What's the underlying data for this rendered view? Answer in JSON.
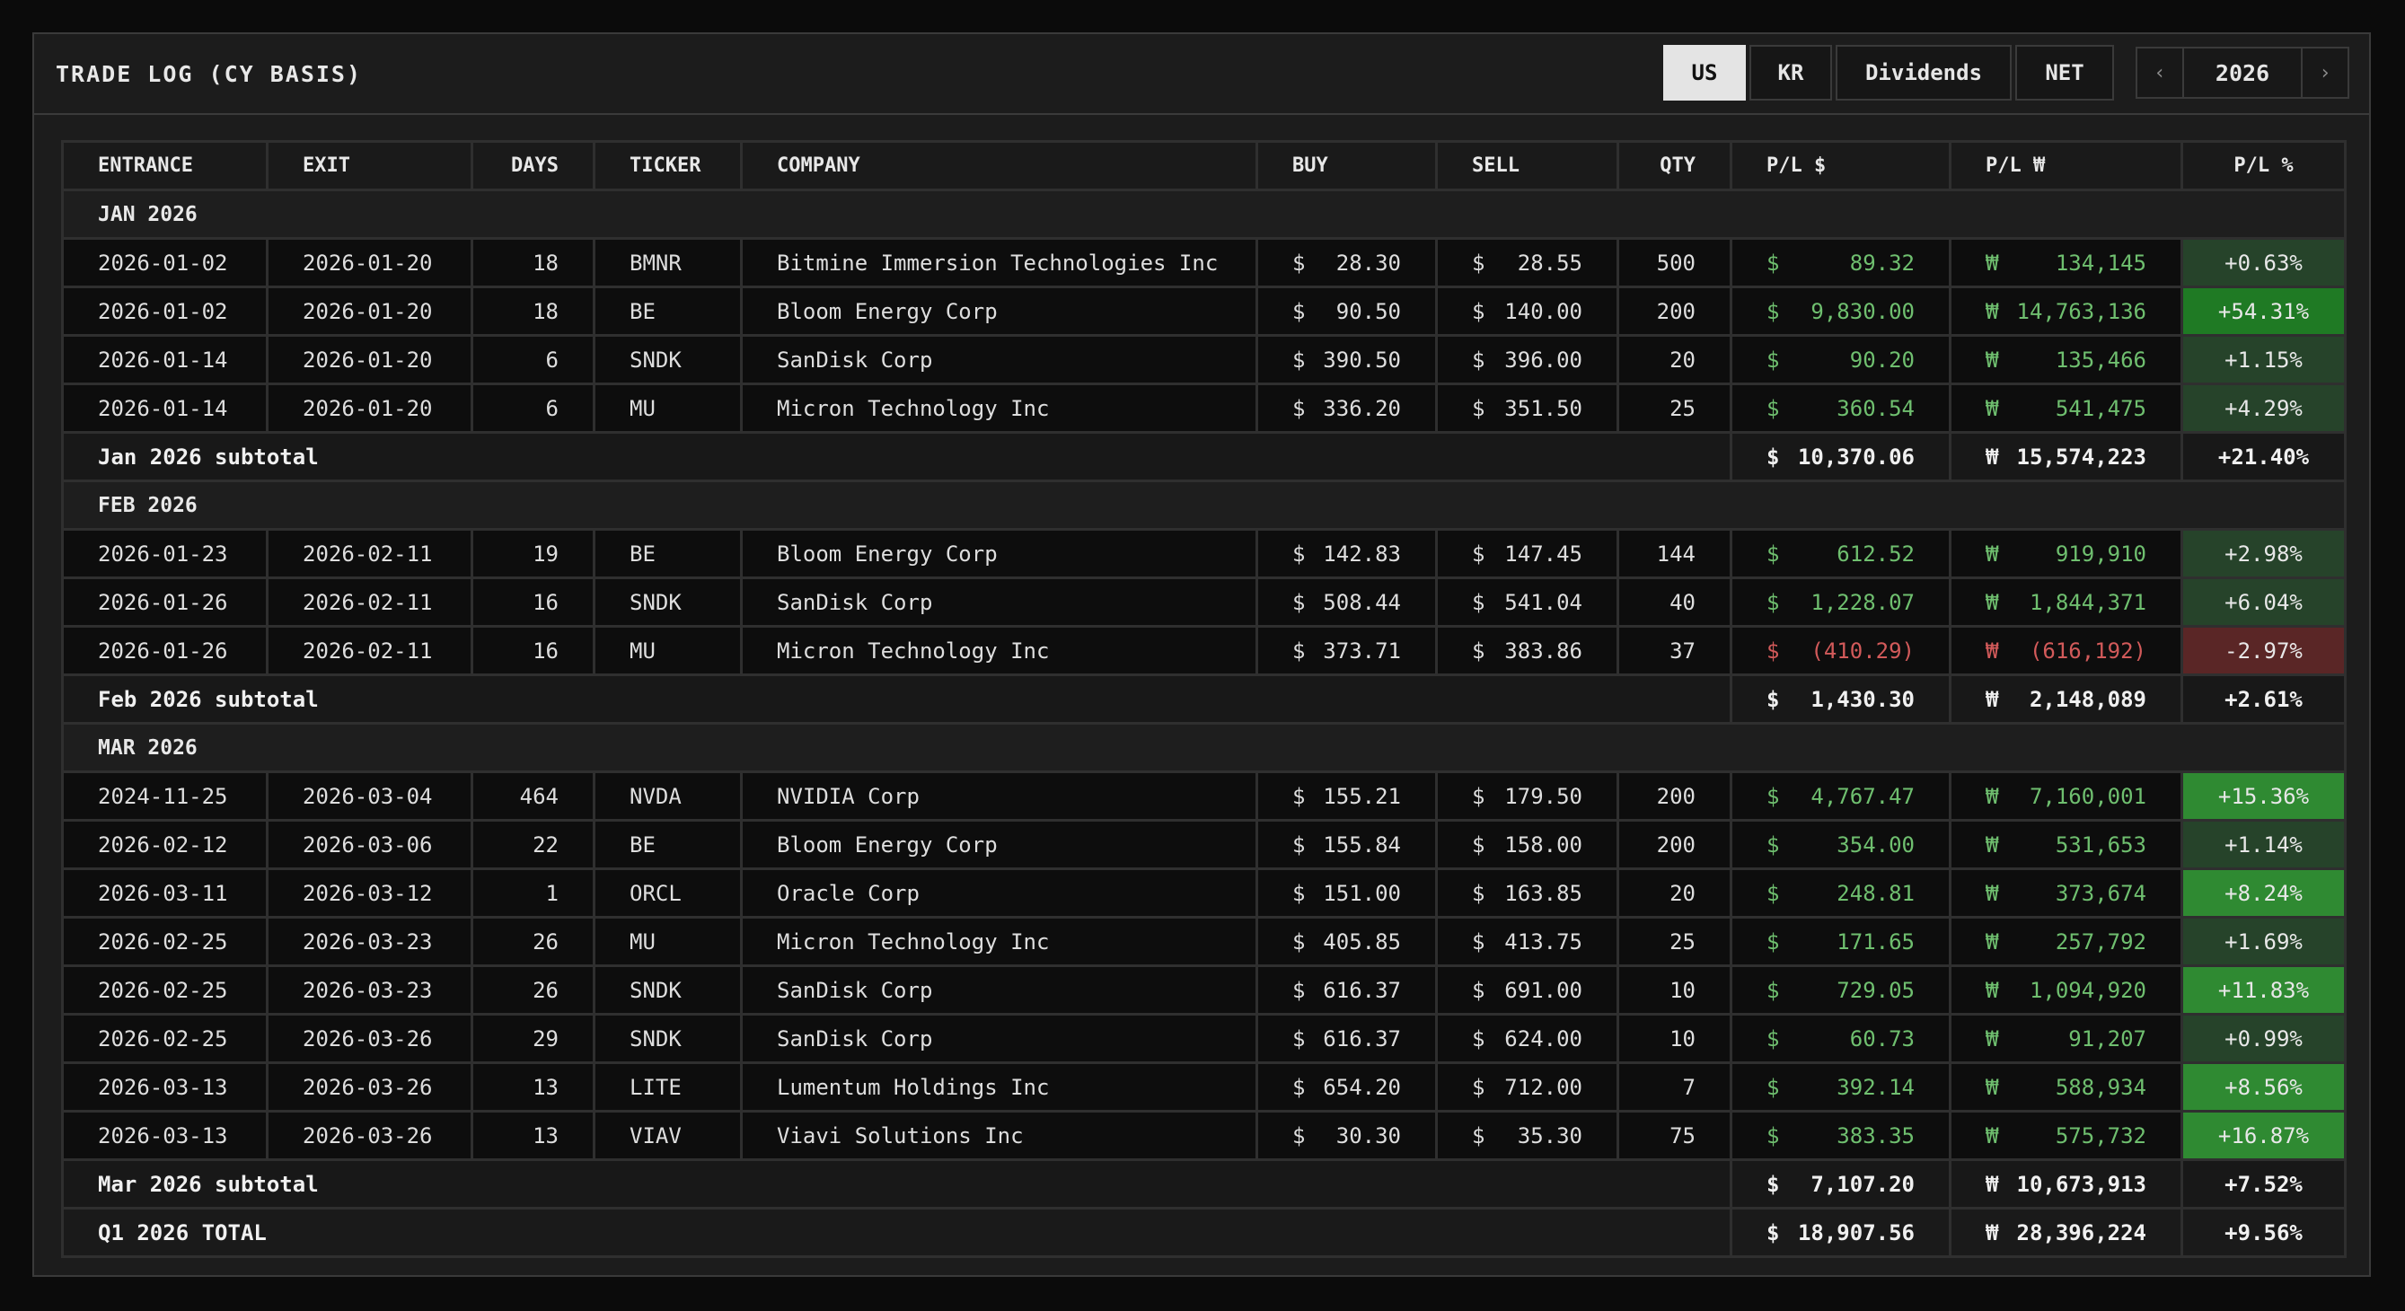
{
  "header": {
    "title": "TRADE LOG (CY BASIS)",
    "tabs": [
      {
        "label": "US",
        "active": true
      },
      {
        "label": "KR",
        "active": false
      },
      {
        "label": "Dividends",
        "active": false
      },
      {
        "label": "NET",
        "active": false
      }
    ],
    "prev_icon": "‹",
    "year": "2026",
    "next_icon": "›"
  },
  "columns": [
    "ENTRANCE",
    "EXIT",
    "DAYS",
    "TICKER",
    "COMPANY",
    "BUY",
    "SELL",
    "QTY",
    "P/L $",
    "P/L ₩",
    "P/L %"
  ],
  "months": [
    {
      "label": "JAN 2026",
      "rows": [
        {
          "entrance": "2026-01-02",
          "exit": "2026-01-20",
          "days": "18",
          "ticker": "BMNR",
          "company": "Bitmine Immersion Technologies Inc",
          "buy": "28.30",
          "sell": "28.55",
          "qty": "500",
          "pl_usd": "89.32",
          "pl_krw": "134,145",
          "pl_pct": "+0.63%",
          "level": "lvl1"
        },
        {
          "entrance": "2026-01-02",
          "exit": "2026-01-20",
          "days": "18",
          "ticker": "BE",
          "company": "Bloom Energy Corp",
          "buy": "90.50",
          "sell": "140.00",
          "qty": "200",
          "pl_usd": "9,830.00",
          "pl_krw": "14,763,136",
          "pl_pct": "+54.31%",
          "level": "lvl3"
        },
        {
          "entrance": "2026-01-14",
          "exit": "2026-01-20",
          "days": "6",
          "ticker": "SNDK",
          "company": "SanDisk Corp",
          "buy": "390.50",
          "sell": "396.00",
          "qty": "20",
          "pl_usd": "90.20",
          "pl_krw": "135,466",
          "pl_pct": "+1.15%",
          "level": "lvl1"
        },
        {
          "entrance": "2026-01-14",
          "exit": "2026-01-20",
          "days": "6",
          "ticker": "MU",
          "company": "Micron Technology Inc",
          "buy": "336.20",
          "sell": "351.50",
          "qty": "25",
          "pl_usd": "360.54",
          "pl_krw": "541,475",
          "pl_pct": "+4.29%",
          "level": "lvl1"
        }
      ],
      "subtotal": {
        "label": "Jan 2026 subtotal",
        "pl_usd": "10,370.06",
        "pl_krw": "15,574,223",
        "pl_pct": "+21.40%"
      }
    },
    {
      "label": "FEB 2026",
      "rows": [
        {
          "entrance": "2026-01-23",
          "exit": "2026-02-11",
          "days": "19",
          "ticker": "BE",
          "company": "Bloom Energy Corp",
          "buy": "142.83",
          "sell": "147.45",
          "qty": "144",
          "pl_usd": "612.52",
          "pl_krw": "919,910",
          "pl_pct": "+2.98%",
          "level": "lvl1"
        },
        {
          "entrance": "2026-01-26",
          "exit": "2026-02-11",
          "days": "16",
          "ticker": "SNDK",
          "company": "SanDisk Corp",
          "buy": "508.44",
          "sell": "541.04",
          "qty": "40",
          "pl_usd": "1,228.07",
          "pl_krw": "1,844,371",
          "pl_pct": "+6.04%",
          "level": "lvl1"
        },
        {
          "entrance": "2026-01-26",
          "exit": "2026-02-11",
          "days": "16",
          "ticker": "MU",
          "company": "Micron Technology Inc",
          "buy": "373.71",
          "sell": "383.86",
          "qty": "37",
          "pl_usd": "(410.29)",
          "pl_krw": "(616,192)",
          "pl_pct": "-2.97%",
          "level": "neg"
        }
      ],
      "subtotal": {
        "label": "Feb 2026 subtotal",
        "pl_usd": "1,430.30",
        "pl_krw": "2,148,089",
        "pl_pct": "+2.61%"
      }
    },
    {
      "label": "MAR 2026",
      "rows": [
        {
          "entrance": "2024-11-25",
          "exit": "2026-03-04",
          "days": "464",
          "ticker": "NVDA",
          "company": "NVIDIA Corp",
          "buy": "155.21",
          "sell": "179.50",
          "qty": "200",
          "pl_usd": "4,767.47",
          "pl_krw": "7,160,001",
          "pl_pct": "+15.36%",
          "level": "lvl2"
        },
        {
          "entrance": "2026-02-12",
          "exit": "2026-03-06",
          "days": "22",
          "ticker": "BE",
          "company": "Bloom Energy Corp",
          "buy": "155.84",
          "sell": "158.00",
          "qty": "200",
          "pl_usd": "354.00",
          "pl_krw": "531,653",
          "pl_pct": "+1.14%",
          "level": "lvl1"
        },
        {
          "entrance": "2026-03-11",
          "exit": "2026-03-12",
          "days": "1",
          "ticker": "ORCL",
          "company": "Oracle Corp",
          "buy": "151.00",
          "sell": "163.85",
          "qty": "20",
          "pl_usd": "248.81",
          "pl_krw": "373,674",
          "pl_pct": "+8.24%",
          "level": "lvl2"
        },
        {
          "entrance": "2026-02-25",
          "exit": "2026-03-23",
          "days": "26",
          "ticker": "MU",
          "company": "Micron Technology Inc",
          "buy": "405.85",
          "sell": "413.75",
          "qty": "25",
          "pl_usd": "171.65",
          "pl_krw": "257,792",
          "pl_pct": "+1.69%",
          "level": "lvl1"
        },
        {
          "entrance": "2026-02-25",
          "exit": "2026-03-23",
          "days": "26",
          "ticker": "SNDK",
          "company": "SanDisk Corp",
          "buy": "616.37",
          "sell": "691.00",
          "qty": "10",
          "pl_usd": "729.05",
          "pl_krw": "1,094,920",
          "pl_pct": "+11.83%",
          "level": "lvl2"
        },
        {
          "entrance": "2026-02-25",
          "exit": "2026-03-26",
          "days": "29",
          "ticker": "SNDK",
          "company": "SanDisk Corp",
          "buy": "616.37",
          "sell": "624.00",
          "qty": "10",
          "pl_usd": "60.73",
          "pl_krw": "91,207",
          "pl_pct": "+0.99%",
          "level": "lvl1"
        },
        {
          "entrance": "2026-03-13",
          "exit": "2026-03-26",
          "days": "13",
          "ticker": "LITE",
          "company": "Lumentum Holdings Inc",
          "buy": "654.20",
          "sell": "712.00",
          "qty": "7",
          "pl_usd": "392.14",
          "pl_krw": "588,934",
          "pl_pct": "+8.56%",
          "level": "lvl2"
        },
        {
          "entrance": "2026-03-13",
          "exit": "2026-03-26",
          "days": "13",
          "ticker": "VIAV",
          "company": "Viavi Solutions Inc",
          "buy": "30.30",
          "sell": "35.30",
          "qty": "75",
          "pl_usd": "383.35",
          "pl_krw": "575,732",
          "pl_pct": "+16.87%",
          "level": "lvl2"
        }
      ],
      "subtotal": {
        "label": "Mar 2026 subtotal",
        "pl_usd": "7,107.20",
        "pl_krw": "10,673,913",
        "pl_pct": "+7.52%"
      }
    }
  ],
  "total": {
    "label": "Q1 2026 TOTAL",
    "pl_usd": "18,907.56",
    "pl_krw": "28,396,224",
    "pl_pct": "+9.56%"
  },
  "currency": {
    "usd": "$",
    "krw": "₩"
  },
  "colors": {
    "positive": "#6fbf6f",
    "negative": "#d25a5a",
    "pct_low": "#26432a",
    "pct_high": "#2f8a32",
    "pct_neg": "#5a2626"
  }
}
